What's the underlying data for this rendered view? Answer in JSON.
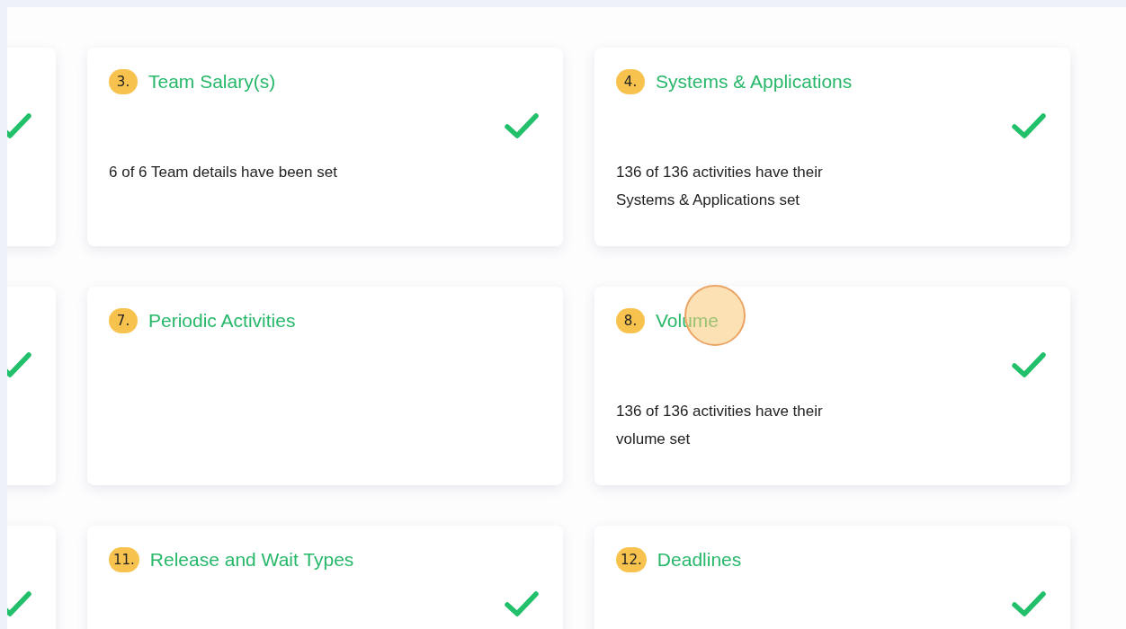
{
  "rows": [
    {
      "cards": [
        {
          "kind": "partial",
          "complete": true
        },
        {
          "kind": "full",
          "number": "3.",
          "title": "Team Salary(s)",
          "complete": true,
          "description": "6 of 6 Team details have been set",
          "clicked": false
        },
        {
          "kind": "full",
          "number": "4.",
          "title": "Systems & Applications",
          "complete": true,
          "description": "136 of 136 activities have their Systems & Applications set",
          "clicked": false
        }
      ]
    },
    {
      "cards": [
        {
          "kind": "partial",
          "complete": true
        },
        {
          "kind": "full",
          "number": "7.",
          "title": "Periodic Activities",
          "complete": false,
          "clicked": false
        },
        {
          "kind": "full",
          "number": "8.",
          "title": "Volume",
          "complete": true,
          "description": "136 of 136 activities have their volume set",
          "clicked": true
        }
      ]
    },
    {
      "cards": [
        {
          "kind": "partial",
          "complete": true
        },
        {
          "kind": "full",
          "number": "11.",
          "title": "Release and Wait Types",
          "complete": true,
          "clicked": false
        },
        {
          "kind": "full",
          "number": "12.",
          "title": "Deadlines",
          "complete": true,
          "clicked": false
        }
      ]
    }
  ]
}
